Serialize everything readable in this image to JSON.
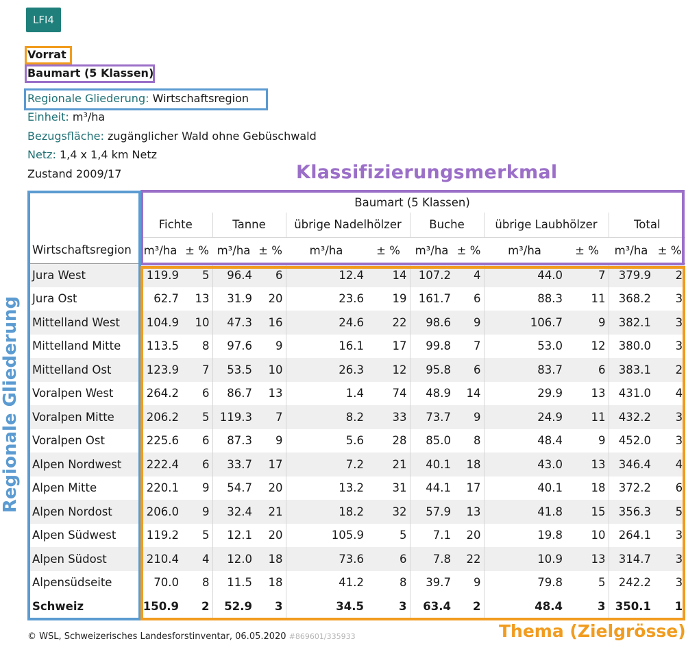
{
  "logo": "LFI4",
  "meta": {
    "vorrat": "Vorrat",
    "baumart": "Baumart (5 Klassen)",
    "gliederung_label": "Regionale Gliederung:",
    "gliederung_value": "Wirtschaftsregion",
    "einheit_label": "Einheit:",
    "einheit_value": "m³/ha",
    "bezug_label": "Bezugsfläche:",
    "bezug_value": "zugänglicher Wald ohne Gebüschwald",
    "netz_label": "Netz:",
    "netz_value": "1,4 x 1,4 km Netz",
    "zustand": "Zustand 2009/17"
  },
  "annotations": {
    "klassifizierung": "Klassifizierungsmerkmal",
    "regionale": "Regionale Gliederung",
    "thema": "Thema (Zielgrösse)"
  },
  "table": {
    "group_header": "Baumart (5 Klassen)",
    "region_header": "Wirtschaftsregion",
    "unit": "m³/ha",
    "pct": "± %",
    "columns": [
      "Fichte",
      "Tanne",
      "übrige Nadelhölzer",
      "Buche",
      "übrige Laubhölzer",
      "Total"
    ],
    "rows": [
      {
        "region": "Jura West",
        "v": [
          "119.9",
          "5",
          "96.4",
          "6",
          "12.4",
          "14",
          "107.2",
          "4",
          "44.0",
          "7",
          "379.9",
          "2"
        ]
      },
      {
        "region": "Jura Ost",
        "v": [
          "62.7",
          "13",
          "31.9",
          "20",
          "23.6",
          "19",
          "161.7",
          "6",
          "88.3",
          "11",
          "368.2",
          "3"
        ]
      },
      {
        "region": "Mittelland West",
        "v": [
          "104.9",
          "10",
          "47.3",
          "16",
          "24.6",
          "22",
          "98.6",
          "9",
          "106.7",
          "9",
          "382.1",
          "3"
        ]
      },
      {
        "region": "Mittelland Mitte",
        "v": [
          "113.5",
          "8",
          "97.6",
          "9",
          "16.1",
          "17",
          "99.8",
          "7",
          "53.0",
          "12",
          "380.0",
          "3"
        ]
      },
      {
        "region": "Mittelland Ost",
        "v": [
          "123.9",
          "7",
          "53.5",
          "10",
          "26.3",
          "12",
          "95.8",
          "6",
          "83.7",
          "6",
          "383.1",
          "2"
        ]
      },
      {
        "region": "Voralpen West",
        "v": [
          "264.2",
          "6",
          "86.7",
          "13",
          "1.4",
          "74",
          "48.9",
          "14",
          "29.9",
          "13",
          "431.0",
          "4"
        ]
      },
      {
        "region": "Voralpen Mitte",
        "v": [
          "206.2",
          "5",
          "119.3",
          "7",
          "8.2",
          "33",
          "73.7",
          "9",
          "24.9",
          "11",
          "432.2",
          "3"
        ]
      },
      {
        "region": "Voralpen Ost",
        "v": [
          "225.6",
          "6",
          "87.3",
          "9",
          "5.6",
          "28",
          "85.0",
          "8",
          "48.4",
          "9",
          "452.0",
          "3"
        ]
      },
      {
        "region": "Alpen Nordwest",
        "v": [
          "222.4",
          "6",
          "33.7",
          "17",
          "7.2",
          "21",
          "40.1",
          "18",
          "43.0",
          "13",
          "346.4",
          "4"
        ]
      },
      {
        "region": "Alpen Mitte",
        "v": [
          "220.1",
          "9",
          "54.7",
          "20",
          "13.2",
          "31",
          "44.1",
          "17",
          "40.1",
          "18",
          "372.2",
          "6"
        ]
      },
      {
        "region": "Alpen Nordost",
        "v": [
          "206.0",
          "9",
          "32.4",
          "21",
          "18.2",
          "32",
          "57.9",
          "13",
          "41.8",
          "15",
          "356.3",
          "5"
        ]
      },
      {
        "region": "Alpen Südwest",
        "v": [
          "119.2",
          "5",
          "12.1",
          "20",
          "105.9",
          "5",
          "7.1",
          "20",
          "19.8",
          "10",
          "264.1",
          "3"
        ]
      },
      {
        "region": "Alpen Südost",
        "v": [
          "210.4",
          "4",
          "12.0",
          "18",
          "73.6",
          "6",
          "7.8",
          "22",
          "10.9",
          "13",
          "314.7",
          "3"
        ]
      },
      {
        "region": "Alpensüdseite",
        "v": [
          "70.0",
          "8",
          "11.5",
          "18",
          "41.2",
          "8",
          "39.7",
          "9",
          "79.8",
          "5",
          "242.2",
          "3"
        ]
      },
      {
        "region": "Schweiz",
        "total": true,
        "v": [
          "150.9",
          "2",
          "52.9",
          "3",
          "34.5",
          "3",
          "63.4",
          "2",
          "48.4",
          "3",
          "350.1",
          "1"
        ]
      }
    ]
  },
  "footer": {
    "text": "© WSL, Schweizerisches Landesforstinventar, 06.05.2020",
    "id": "#869601/335933"
  },
  "colors": {
    "orange": "#f19c1f",
    "purple": "#9b6fc8",
    "blue": "#5b9bd1",
    "teal": "#1f7074"
  }
}
